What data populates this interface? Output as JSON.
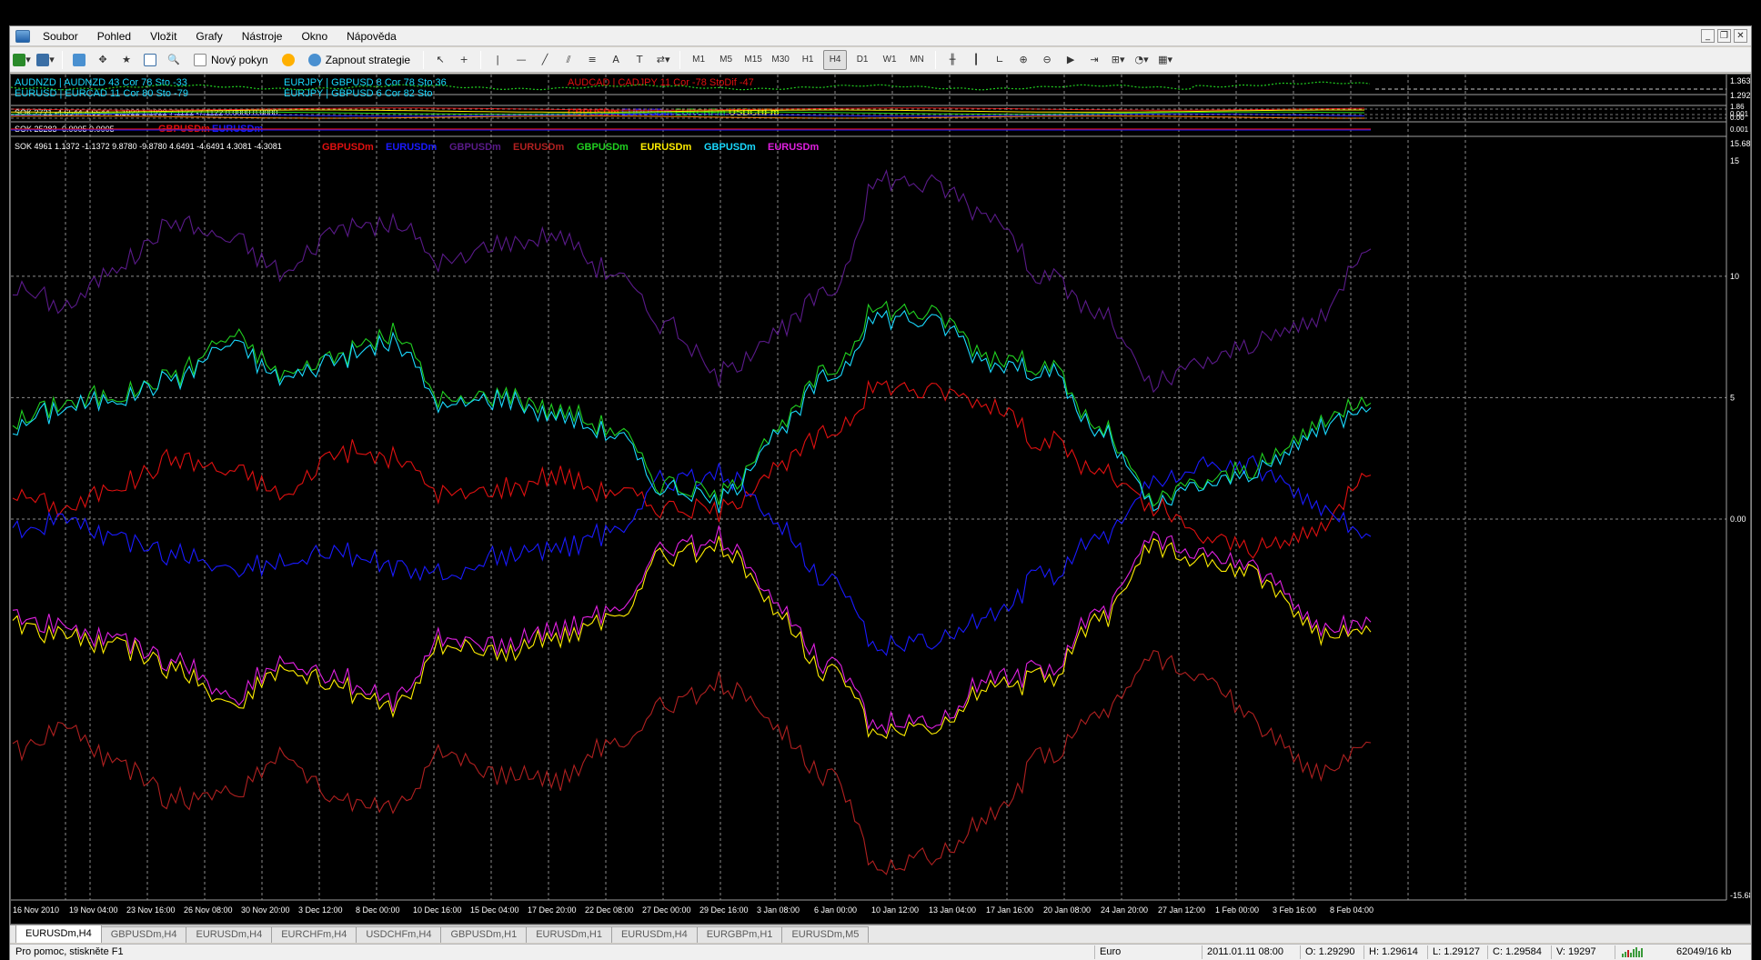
{
  "menu": [
    "Soubor",
    "Pohled",
    "Vložit",
    "Grafy",
    "Nástroje",
    "Okno",
    "Nápověda"
  ],
  "toolbar": {
    "new_order": "Nový pokyn",
    "autotrade": "Zapnout strategie",
    "timeframes": [
      "M1",
      "M5",
      "M15",
      "M30",
      "H1",
      "H4",
      "D1",
      "W1",
      "MN"
    ],
    "active_timeframe": "H4"
  },
  "window_buttons": [
    "_",
    "❐",
    "✕"
  ],
  "subwindows": {
    "w1": {
      "labels": [
        {
          "text": "AUDNZD | AUDNZD  43   Cor  78   Sto  -33",
          "color": "#19d9ff"
        },
        {
          "text": "EURJPY | GBPUSD  8   Cor  78   Sto  36",
          "color": "#19d9ff"
        },
        {
          "text": "AUDCAD | CADJPY  11   Cor  -78   StoDif  -47",
          "color": "#e01010"
        },
        {
          "text": "EURUSD | EURCAD  11   Cor  80   Sto  -79",
          "color": "#19d9ff"
        },
        {
          "text": "EURJPY | GBPUSD  6   Cor  82   Sto",
          "color": "#19d9ff"
        }
      ],
      "price_top": "1.36383",
      "price_bottom": "1.29270"
    },
    "w2": {
      "header": "SOK 2721 -4.6544 4.6544 -1.1922 1.1922 7.1122 -7.1122 0.0000 0.0000",
      "legend": [
        {
          "text": "GBPUSDm",
          "color": "#e01010"
        },
        {
          "text": "EURUSDm",
          "color": "#1a1aff"
        },
        {
          "text": "EURCHFm",
          "color": "#20d020"
        },
        {
          "text": "USDCHFm",
          "color": "#ffee00"
        }
      ],
      "scale": [
        "1.86",
        "0.001",
        "0.00"
      ]
    },
    "w3": {
      "header": "SOK 25283 -0.0005 0.0005",
      "legend": [
        {
          "text": "GBPUSDm",
          "color": "#e01010"
        },
        {
          "text": "EURUSDm",
          "color": "#1a1aff"
        }
      ],
      "scale": [
        "0.001"
      ]
    },
    "main": {
      "header": "SOK 4961 1.1372 -1.1372 9.8780 -9.8780 4.6491 -4.6491 4.3081 -4.3081",
      "legend": [
        {
          "text": "GBPUSDm",
          "color": "#e01010"
        },
        {
          "text": "EURUSDm",
          "color": "#1a1aff"
        },
        {
          "text": "GBPUSDm",
          "color": "#5a1a8a"
        },
        {
          "text": "EURUSDm",
          "color": "#b02020"
        },
        {
          "text": "GBPUSDm",
          "color": "#20d020"
        },
        {
          "text": "EURUSDm",
          "color": "#ffee00"
        },
        {
          "text": "GBPUSDm",
          "color": "#19d9ff"
        },
        {
          "text": "EURUSDm",
          "color": "#e020e0"
        }
      ],
      "scale": [
        "15.6828",
        "15",
        "10",
        "5",
        "0.00",
        "-15.6828"
      ]
    }
  },
  "time_axis": [
    "16 Nov 2010",
    "19 Nov 04:00",
    "23 Nov 16:00",
    "26 Nov 08:00",
    "30 Nov 20:00",
    "3 Dec 12:00",
    "8 Dec 00:00",
    "10 Dec 16:00",
    "15 Dec 04:00",
    "17 Dec 20:00",
    "22 Dec 08:00",
    "27 Dec 00:00",
    "29 Dec 16:00",
    "3 Jan 08:00",
    "6 Jan 00:00",
    "10 Jan 12:00",
    "13 Jan 04:00",
    "17 Jan 16:00",
    "20 Jan 08:00",
    "24 Jan 20:00",
    "27 Jan 12:00",
    "1 Feb 00:00",
    "3 Feb 16:00",
    "8 Feb 04:00"
  ],
  "tabs": [
    "EURUSDm,H4",
    "GBPUSDm,H4",
    "EURUSDm,H4",
    "EURCHFm,H4",
    "USDCHFm,H4",
    "GBPUSDm,H1",
    "EURUSDm,H1",
    "EURUSDm,H4",
    "EURGBPm,H1",
    "EURUSDm,M5"
  ],
  "active_tab": 0,
  "status": {
    "help": "Pro pomoc, stiskněte F1",
    "profile": "Euro",
    "datetime": "2011.01.11 08:00",
    "open": "O: 1.29290",
    "high": "H: 1.29614",
    "low": "L: 1.29127",
    "close": "C: 1.29584",
    "volume": "V: 19297",
    "traffic": "62049/16 kb"
  },
  "colors": {
    "background": "#000000",
    "grid": "#c8c8c8",
    "axis_text": "#ffffff"
  },
  "chart_data": {
    "type": "line",
    "ylim": [
      -15.6828,
      15.6828
    ],
    "x": [
      "16 Nov 2010",
      "19 Nov 04:00",
      "23 Nov 16:00",
      "26 Nov 08:00",
      "30 Nov 20:00",
      "3 Dec 12:00",
      "8 Dec 00:00",
      "10 Dec 16:00",
      "15 Dec 04:00",
      "17 Dec 20:00",
      "22 Dec 08:00",
      "27 Dec 00:00",
      "29 Dec 16:00",
      "3 Jan 08:00",
      "6 Jan 00:00",
      "10 Jan 12:00",
      "13 Jan 04:00",
      "17 Jan 16:00",
      "20 Jan 08:00",
      "24 Jan 20:00",
      "27 Jan 12:00",
      "1 Feb 00:00",
      "3 Feb 16:00",
      "8 Feb 04:00"
    ],
    "series": [
      {
        "name": "GBPUSDm",
        "color": "#e01010",
        "values": [
          1.0,
          0.5,
          1.5,
          2.5,
          2.0,
          1.0,
          2.8,
          2.5,
          1.0,
          1.3,
          1.8,
          1.2,
          0.5,
          0.3,
          2.0,
          3.5,
          5.5,
          5.3,
          4.8,
          3.2,
          2.0,
          0.4,
          -0.8,
          -1.2,
          -0.5,
          2.2
        ]
      },
      {
        "name": "EURUSDm",
        "color": "#1a1aff",
        "values": [
          -0.5,
          0.0,
          -0.9,
          -1.5,
          -2.0,
          -1.8,
          -1.4,
          -1.9,
          -2.3,
          -1.6,
          -1.2,
          -0.6,
          1.5,
          1.9,
          0.0,
          -2.5,
          -5.3,
          -5.0,
          -4.1,
          -2.3,
          -0.8,
          1.6,
          2.3,
          2.1,
          0.6,
          -1.0
        ]
      },
      {
        "name": "GBPUSDm",
        "color": "#5a1a8a",
        "values": [
          9.5,
          8.8,
          10.6,
          12.2,
          11.5,
          10.2,
          12.0,
          12.2,
          10.5,
          11.4,
          11.7,
          10.2,
          8.1,
          6.0,
          7.6,
          9.2,
          14.0,
          13.7,
          12.6,
          10.0,
          8.5,
          5.5,
          6.5,
          7.4,
          8.2,
          11.4
        ]
      },
      {
        "name": "EURUSDm",
        "color": "#b02020",
        "values": [
          -9.5,
          -8.6,
          -10.2,
          -11.6,
          -11.2,
          -9.8,
          -11.6,
          -11.8,
          -9.6,
          -10.6,
          -10.8,
          -9.4,
          -7.8,
          -6.8,
          -8.4,
          -10.5,
          -14.5,
          -13.8,
          -12.4,
          -9.8,
          -8.0,
          -5.6,
          -6.6,
          -8.6,
          -10.4,
          -9.6
        ]
      },
      {
        "name": "GBPUSDm",
        "color": "#20d020",
        "values": [
          4.0,
          4.8,
          5.2,
          6.0,
          7.5,
          6.0,
          6.8,
          7.6,
          4.8,
          5.2,
          4.5,
          3.8,
          1.5,
          1.0,
          3.5,
          6.0,
          8.7,
          8.4,
          6.8,
          6.4,
          3.8,
          0.8,
          1.6,
          2.2,
          3.8,
          5.2
        ]
      },
      {
        "name": "EURUSDm",
        "color": "#ffee00",
        "values": [
          -4.3,
          -4.8,
          -5.3,
          -6.2,
          -7.6,
          -6.2,
          -6.9,
          -7.7,
          -5.1,
          -5.6,
          -4.9,
          -4.2,
          -1.6,
          -1.1,
          -3.6,
          -6.2,
          -8.8,
          -8.6,
          -7.0,
          -6.6,
          -4.1,
          -1.0,
          -1.8,
          -2.4,
          -4.6,
          -4.9
        ]
      },
      {
        "name": "GBPUSDm",
        "color": "#19d9ff",
        "values": [
          3.8,
          4.6,
          5.0,
          5.8,
          7.2,
          5.8,
          6.6,
          7.3,
          4.6,
          5.0,
          4.3,
          3.6,
          1.3,
          0.8,
          3.3,
          5.8,
          8.4,
          8.1,
          6.5,
          6.1,
          3.6,
          0.6,
          1.4,
          2.0,
          3.6,
          4.9
        ]
      },
      {
        "name": "EURUSDm",
        "color": "#e020e0",
        "values": [
          -4.0,
          -4.5,
          -5.0,
          -5.9,
          -7.3,
          -5.9,
          -6.6,
          -7.4,
          -4.8,
          -5.3,
          -4.6,
          -3.9,
          -1.3,
          -0.8,
          -3.3,
          -5.9,
          -8.5,
          -8.3,
          -6.7,
          -6.3,
          -3.8,
          -0.7,
          -1.5,
          -2.1,
          -4.3,
          -4.6
        ]
      }
    ]
  }
}
